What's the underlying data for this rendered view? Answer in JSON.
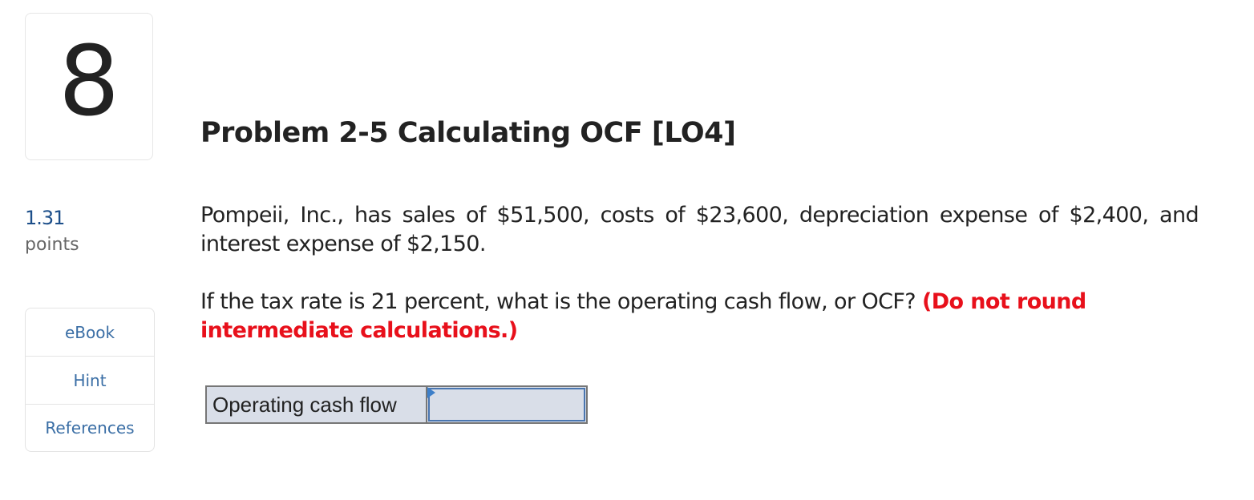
{
  "question": {
    "number": "8",
    "points_value": "1.31",
    "points_label": "points"
  },
  "resources": [
    {
      "label": "eBook"
    },
    {
      "label": "Hint"
    },
    {
      "label": "References"
    }
  ],
  "problem": {
    "title": "Problem 2-5 Calculating OCF [LO4]",
    "paragraph1": "Pompeii, Inc., has sales of $51,500, costs of $23,600, depreciation expense of $2,400, and interest expense of $2,150.",
    "paragraph2_text": "If the tax rate is 21 percent, what is the operating cash flow, or OCF?",
    "paragraph2_emphasis": "(Do not round intermediate calculations.)"
  },
  "answer": {
    "label": "Operating cash flow",
    "value": "",
    "placeholder": ""
  },
  "colors": {
    "link": "#3a6ea5",
    "points": "#1d4f8a",
    "emphasis": "#e8101b",
    "input_bg": "#d9dee8",
    "input_border": "#4a76b0",
    "flag": "#3d7fc9"
  },
  "icons": {
    "input_flag": "flag-triangle-icon"
  }
}
